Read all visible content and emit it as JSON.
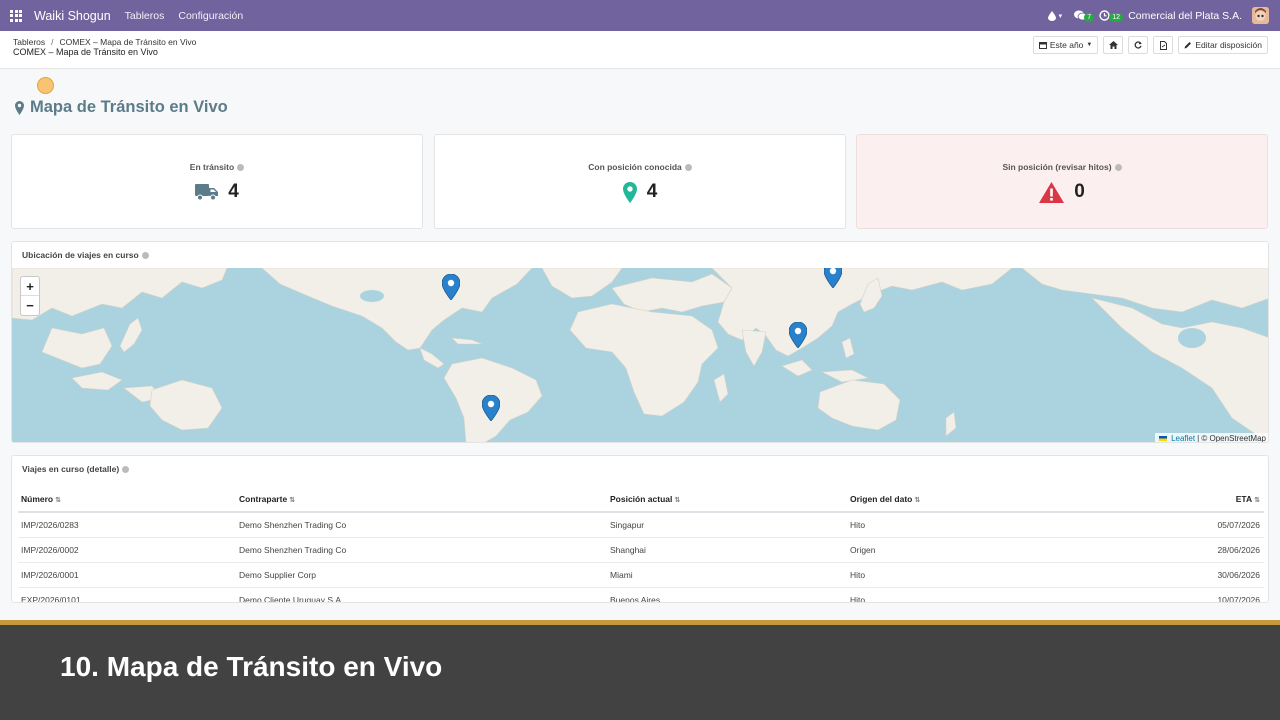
{
  "navbar": {
    "brand": "Waiki Shogun",
    "menu": [
      "Tableros",
      "Configuración"
    ],
    "messages_badge": "7",
    "activities_badge": "12",
    "company": "Comercial del Plata S.A."
  },
  "control": {
    "breadcrumb": [
      "Tableros",
      "COMEX – Mapa de Tránsito en Vivo"
    ],
    "breadcrumb_sep": "/",
    "subtitle": "COMEX – Mapa de Tránsito en Vivo",
    "period_button": "Este año",
    "edit_button": "Editar disposición"
  },
  "dashboard": {
    "title": "Mapa de Tránsito en Vivo"
  },
  "kpis": [
    {
      "label": "En tránsito",
      "value": "4",
      "icon": "truck-icon",
      "color": "#5c7c8a"
    },
    {
      "label": "Con posición conocida",
      "value": "4",
      "icon": "map-marker-icon",
      "color": "#21b799"
    },
    {
      "label": "Sin posición (revisar hitos)",
      "value": "0",
      "icon": "warning-icon",
      "color": "#dc3545"
    }
  ],
  "map_card": {
    "title": "Ubicación de viajes en curso",
    "zoom_in": "+",
    "zoom_out": "−",
    "attribution_link": "Leaflet",
    "attribution_text": "| © OpenStreetMap",
    "pins": [
      "Miami",
      "Shanghai",
      "Singapur",
      "Buenos Aires"
    ]
  },
  "table_card": {
    "title": "Viajes en curso (detalle)",
    "columns": [
      "Número",
      "Contraparte",
      "Posición actual",
      "Origen del dato",
      "ETA"
    ],
    "rows": [
      [
        "IMP/2026/0283",
        "Demo Shenzhen Trading Co",
        "Singapur",
        "Hito",
        "05/07/2026"
      ],
      [
        "IMP/2026/0002",
        "Demo Shenzhen Trading Co",
        "Shanghai",
        "Origen",
        "28/06/2026"
      ],
      [
        "IMP/2026/0001",
        "Demo Supplier Corp",
        "Miami",
        "Hito",
        "30/06/2026"
      ],
      [
        "EXP/2026/0101",
        "Demo Cliente Uruguay S.A.",
        "Buenos Aires",
        "Hito",
        "10/07/2026"
      ]
    ]
  },
  "caption": "10. Mapa de Tránsito en Vivo",
  "colors": {
    "navbar": "#71639e",
    "accent": "#5c7c8a",
    "ocean": "#aad3df",
    "land": "#f2efe9",
    "caption_bar": "#424242",
    "caption_border": "#c99a3b"
  }
}
